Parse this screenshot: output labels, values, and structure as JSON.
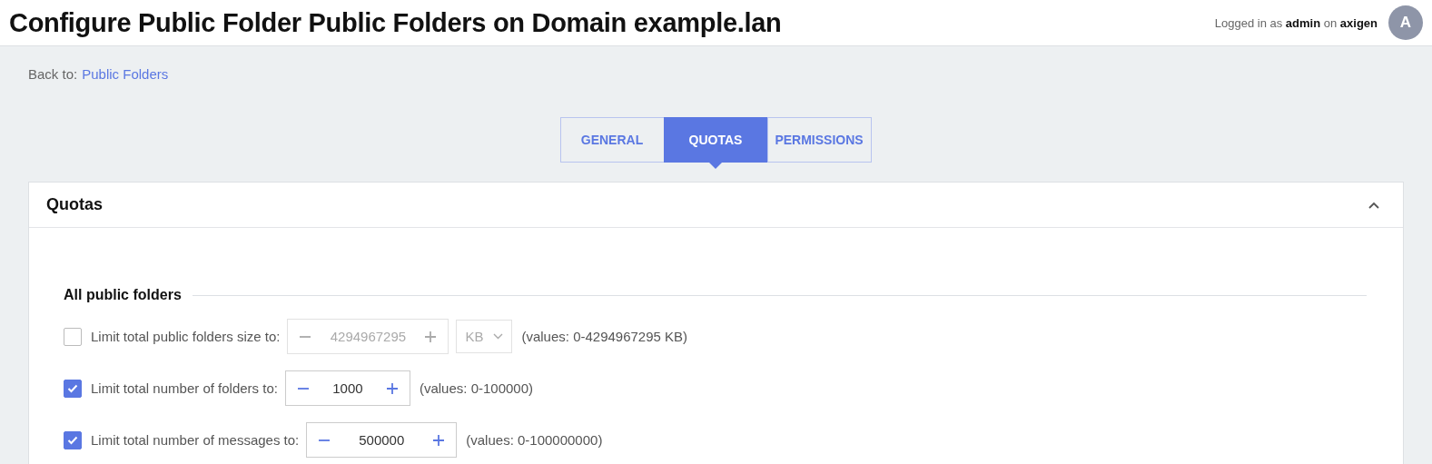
{
  "header": {
    "title": "Configure Public Folder Public Folders on Domain example.lan",
    "login": "Logged in as **admin** on **axigen**",
    "avatar": "A"
  },
  "back": {
    "label": "Back to:",
    "link": "Public Folders"
  },
  "tabs": [
    {
      "label": "GENERAL",
      "selected": false
    },
    {
      "label": "QUOTAS",
      "selected": true
    },
    {
      "label": "PERMISSIONS",
      "selected": false
    }
  ],
  "panel": {
    "title": "Quotas",
    "expanded": true,
    "section": "All public folders",
    "rows": [
      {
        "label": "Limit total public folders size to:",
        "checked": false,
        "value": "4294967295",
        "unit": "KB",
        "hint": "(values: 0-4294967295 KB)"
      },
      {
        "label": "Limit total number of folders to:",
        "checked": true,
        "value": "1000",
        "hint": "(values: 0-100000)"
      },
      {
        "label": "Limit total number of messages to:",
        "checked": true,
        "value": "500000",
        "hint": "(values: 0-100000000)"
      }
    ]
  }
}
